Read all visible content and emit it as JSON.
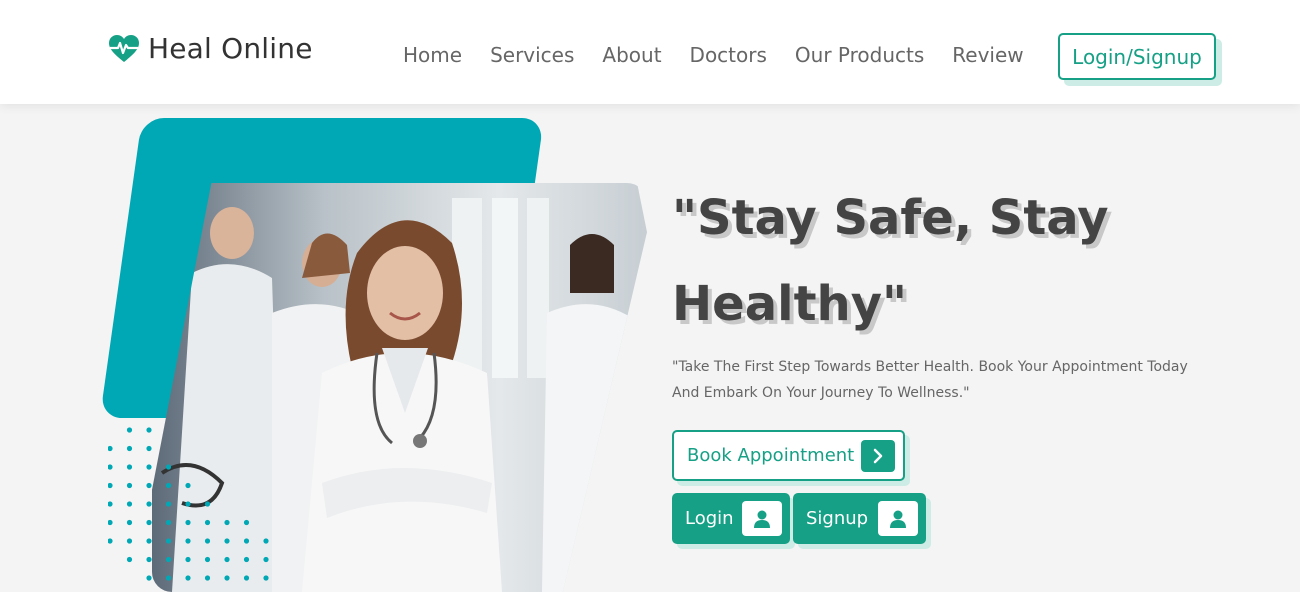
{
  "brand": {
    "name": "Heal Online",
    "icon": "heart-pulse-icon",
    "accent": "#16a085",
    "teal": "#00a8b5"
  },
  "nav": {
    "items": [
      {
        "label": "Home"
      },
      {
        "label": "Services"
      },
      {
        "label": "About"
      },
      {
        "label": "Doctors"
      },
      {
        "label": "Our Products"
      },
      {
        "label": "Review"
      }
    ],
    "login_label": "Login/Signup"
  },
  "hero": {
    "headline_line1": "\"Stay Safe, Stay",
    "headline_line2": "Healthy\"",
    "tagline": "\"Take The First Step Towards Better Health. Book Your Appointment Today And Embark On Your Journey To Wellness.\"",
    "book_label": "Book Appointment",
    "login_label": "Login",
    "signup_label": "Signup"
  }
}
